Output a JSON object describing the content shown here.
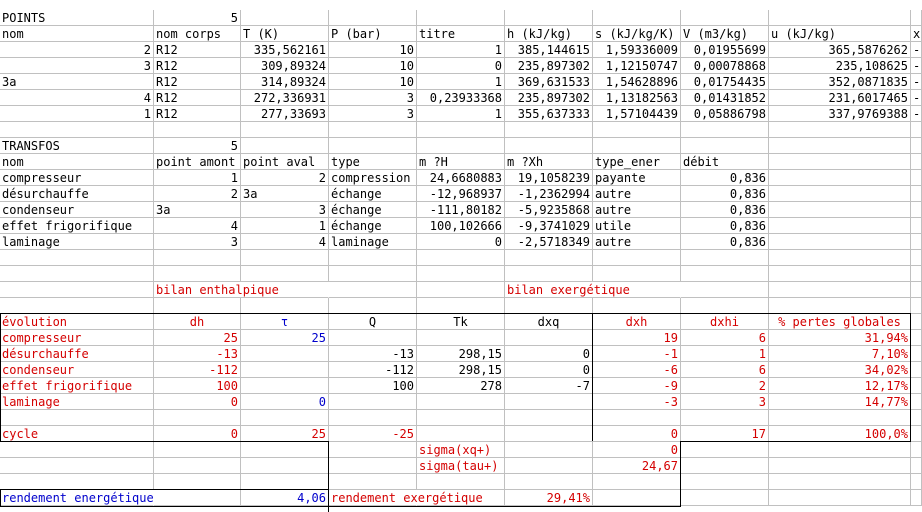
{
  "points": {
    "title": "POINTS",
    "count": "5",
    "headers": [
      "nom",
      "nom corps",
      "T (K)",
      "P (bar)",
      "titre",
      "h (kJ/kg)",
      "s (kJ/kg/K)",
      "V (m3/kg)",
      "u (kJ/kg)",
      "x"
    ],
    "rows": [
      [
        "2",
        "R12",
        "335,562161",
        "10",
        "1",
        "385,144615",
        "1,59336009",
        "0,01955699",
        "365,5876262",
        "-"
      ],
      [
        "3",
        "R12",
        "309,89324",
        "10",
        "0",
        "235,897302",
        "1,12150747",
        "0,00078868",
        "235,108625",
        "-"
      ],
      [
        "3a",
        "R12",
        "314,89324",
        "10",
        "1",
        "369,631533",
        "1,54628896",
        "0,01754435",
        "352,0871835",
        "-"
      ],
      [
        "4",
        "R12",
        "272,336931",
        "3",
        "0,23933368",
        "235,897302",
        "1,13182563",
        "0,01431852",
        "231,6017465",
        "-"
      ],
      [
        "1",
        "R12",
        "277,33693",
        "3",
        "1",
        "355,637333",
        "1,57104439",
        "0,05886798",
        "337,9769388",
        "-"
      ]
    ]
  },
  "transfos": {
    "title": "TRANSFOS",
    "count": "5",
    "headers": [
      "nom",
      "point amont",
      "point aval",
      "type",
      "m ?H",
      "m ?Xh",
      "type_ener",
      "débit"
    ],
    "rows": [
      [
        "compresseur",
        "1",
        "2",
        "compression",
        "24,6680883",
        "19,1058239",
        "payante",
        "0,836"
      ],
      [
        "désurchauffe",
        "2",
        "3a",
        "échange",
        "-12,968937",
        "-1,2362994",
        "autre",
        "0,836"
      ],
      [
        "condenseur",
        "3a",
        "3",
        "échange",
        "-111,80182",
        "-5,9235868",
        "autre",
        "0,836"
      ],
      [
        "effet frigorifique",
        "4",
        "1",
        "échange",
        "100,102666",
        "-9,3741029",
        "utile",
        "0,836"
      ],
      [
        "laminage",
        "3",
        "4",
        "laminage",
        "0",
        "-2,5718349",
        "autre",
        "0,836"
      ]
    ]
  },
  "bilan": {
    "enthalpique_label": "bilan enthalpique",
    "exergetique_label": "bilan exergétique",
    "headers": [
      "évolution",
      "dh",
      "τ",
      "Q",
      "Tk",
      "dxq",
      "dxh",
      "dxhi",
      "% pertes globales"
    ],
    "rows": [
      [
        "compresseur",
        "25",
        "25",
        "",
        "",
        "",
        "19",
        "6",
        "31,94%"
      ],
      [
        "désurchauffe",
        "-13",
        "",
        "-13",
        "298,15",
        "0",
        "-1",
        "1",
        "7,10%"
      ],
      [
        "condenseur",
        "-112",
        "",
        "-112",
        "298,15",
        "0",
        "-6",
        "6",
        "34,02%"
      ],
      [
        "effet frigorifique",
        "100",
        "",
        "100",
        "278",
        "-7",
        "-9",
        "2",
        "12,17%"
      ],
      [
        "laminage",
        "0",
        "0",
        "",
        "",
        "",
        "-3",
        "3",
        "14,77%"
      ]
    ],
    "cycle": [
      "cycle",
      "0",
      "25",
      "-25",
      "",
      "",
      "0",
      "17",
      "100,0%"
    ],
    "sigma_xq_label": "sigma(xq+)",
    "sigma_xq_value": "0",
    "sigma_tau_label": "sigma(tau+)",
    "sigma_tau_value": "24,67",
    "rendement_energetique_label": "rendement energétique",
    "rendement_energetique_value": "4,06",
    "rendement_exergetique_label": "rendement exergétique",
    "rendement_exergetique_value": "29,41%"
  }
}
